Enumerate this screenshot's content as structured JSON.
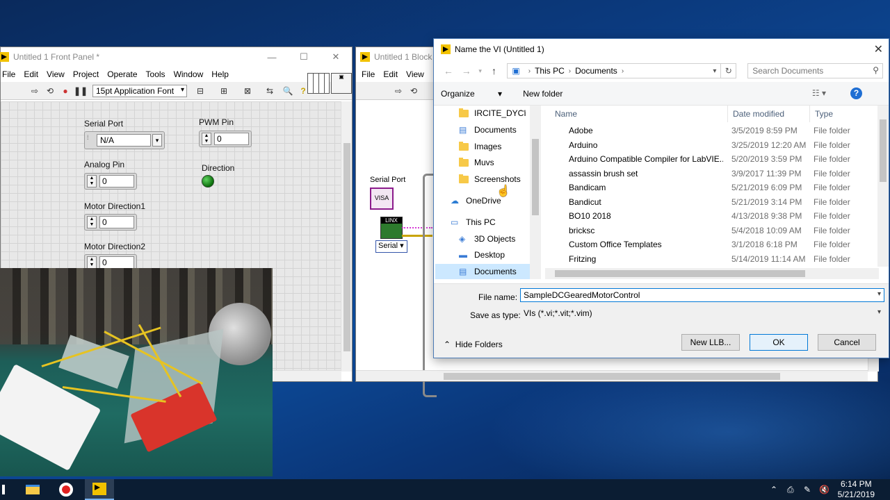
{
  "front_panel": {
    "title": "Untitled 1 Front Panel *",
    "menu": [
      "File",
      "Edit",
      "View",
      "Project",
      "Operate",
      "Tools",
      "Window",
      "Help"
    ],
    "font": "15pt Application Font",
    "controls": {
      "serial_port": {
        "label": "Serial Port",
        "value": "N/A"
      },
      "pwm_pin": {
        "label": "PWM Pin",
        "value": "0"
      },
      "analog_pin": {
        "label": "Analog Pin",
        "value": "0"
      },
      "direction": {
        "label": "Direction"
      },
      "motor_direction1": {
        "label": "Motor Direction1",
        "value": "0"
      },
      "motor_direction2": {
        "label": "Motor Direction2",
        "value": "0"
      }
    }
  },
  "block_diagram": {
    "title": "Untitled 1 Block",
    "menu": [
      "File",
      "Edit",
      "View"
    ],
    "terminal_label": "Serial Port",
    "visa_text": "VISA",
    "init_text": "LINX",
    "serial_label": "Serial"
  },
  "dialog": {
    "title": "Name the VI (Untitled 1)",
    "breadcrumb": [
      "This PC",
      "Documents"
    ],
    "search_placeholder": "Search Documents",
    "organize": "Organize",
    "new_folder": "New folder",
    "nav_items": [
      {
        "label": "IRCITE_DYCI",
        "type": "folder"
      },
      {
        "label": "Documents",
        "type": "doc"
      },
      {
        "label": "Images",
        "type": "folder"
      },
      {
        "label": "Muvs",
        "type": "folder"
      },
      {
        "label": "Screenshots",
        "type": "folder"
      },
      {
        "label": "OneDrive",
        "type": "cloud"
      },
      {
        "label": "This PC",
        "type": "pc"
      },
      {
        "label": "3D Objects",
        "type": "3d"
      },
      {
        "label": "Desktop",
        "type": "desktop"
      },
      {
        "label": "Documents",
        "type": "doc"
      }
    ],
    "columns": [
      "Name",
      "Date modified",
      "Type"
    ],
    "rows": [
      {
        "name": "Adobe",
        "date": "3/5/2019 8:59 PM",
        "type": "File folder"
      },
      {
        "name": "Arduino",
        "date": "3/25/2019 12:20 AM",
        "type": "File folder"
      },
      {
        "name": "Arduino Compatible Compiler for LabVIE...",
        "date": "5/20/2019 3:59 PM",
        "type": "File folder"
      },
      {
        "name": "assassin brush set",
        "date": "3/9/2017 11:39 PM",
        "type": "File folder"
      },
      {
        "name": "Bandicam",
        "date": "5/21/2019 6:09 PM",
        "type": "File folder"
      },
      {
        "name": "Bandicut",
        "date": "5/21/2019 3:14 PM",
        "type": "File folder"
      },
      {
        "name": "BO10 2018",
        "date": "4/13/2018 9:38 PM",
        "type": "File folder"
      },
      {
        "name": "bricksc",
        "date": "5/4/2018 10:09 AM",
        "type": "File folder"
      },
      {
        "name": "Custom Office Templates",
        "date": "3/1/2018 6:18 PM",
        "type": "File folder"
      },
      {
        "name": "Fritzing",
        "date": "5/14/2019 11:14 AM",
        "type": "File folder"
      }
    ],
    "file_name_label": "File name:",
    "file_name_value": "SampleDCGearedMotorControl",
    "save_type_label": "Save as type:",
    "save_type_value": "VIs (*.vi;*.vit;*.vim)",
    "hide_folders": "Hide Folders",
    "new_llb": "New LLB...",
    "ok": "OK",
    "cancel": "Cancel"
  },
  "taskbar": {
    "time": "6:14 PM",
    "date": "5/21/2019"
  }
}
